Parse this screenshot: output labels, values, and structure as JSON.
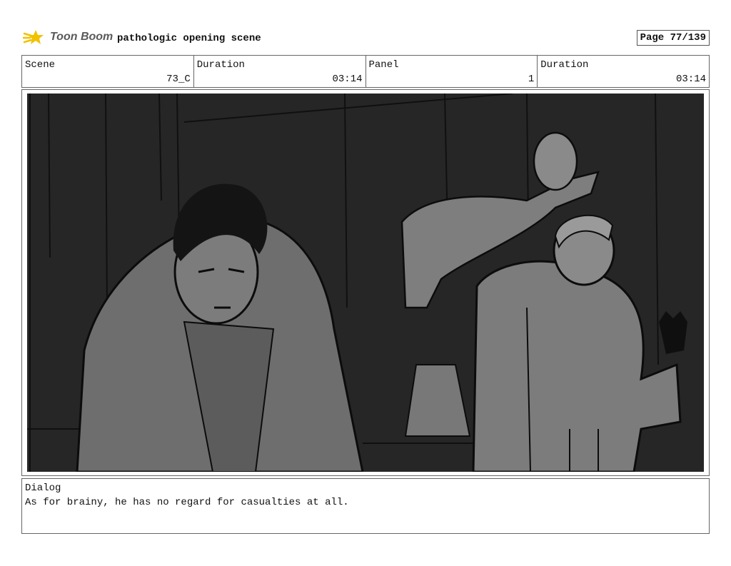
{
  "header": {
    "logo_text": "Toon Boom",
    "title": "pathologic opening scene",
    "page_label": "Page",
    "page_value": "77/139"
  },
  "info": {
    "scene_label": "Scene",
    "scene_value": "73_C",
    "duration_label": "Duration",
    "duration_value": "03:14",
    "panel_label": "Panel",
    "panel_value": "1",
    "duration2_label": "Duration",
    "duration2_value": "03:14"
  },
  "panel": {
    "background_color": "#262626",
    "figure_color": "#7a7a7a"
  },
  "dialog": {
    "label": "Dialog",
    "text": "As for brainy, he has no regard for casualties at all."
  }
}
